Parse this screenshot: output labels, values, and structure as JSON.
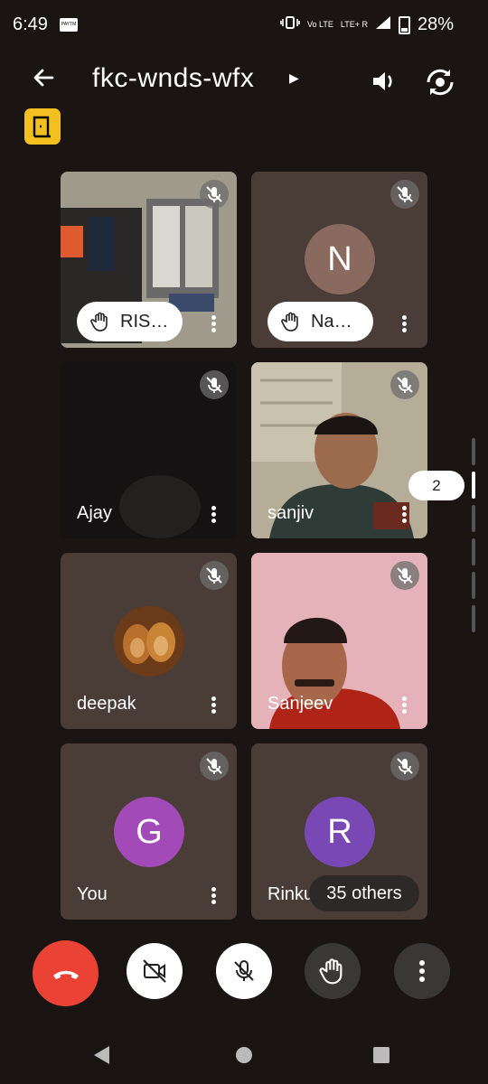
{
  "status_bar": {
    "time": "6:49",
    "app_icon_text": "PAYTM",
    "network": "Vo LTE",
    "network2": "LTE+ R",
    "battery": "28%"
  },
  "header": {
    "meeting_code": "fkc-wnds-wfx",
    "icons": [
      "back-arrow-icon",
      "speaker-icon",
      "switch-camera-icon",
      "exit-door-icon"
    ]
  },
  "participants": [
    {
      "name": "RIS…",
      "hand_raised": true,
      "kind": "video-room"
    },
    {
      "name": "Na…",
      "hand_raised": true,
      "kind": "avatar",
      "initial": "N",
      "color": "#8a6a5f"
    },
    {
      "name": "Ajay",
      "hand_raised": false,
      "kind": "video-dark"
    },
    {
      "name": "sanjiv",
      "hand_raised": false,
      "kind": "video-man1"
    },
    {
      "name": "deepak",
      "hand_raised": false,
      "kind": "lion-avatar"
    },
    {
      "name": "Sanjeev",
      "hand_raised": false,
      "kind": "video-man2"
    },
    {
      "name": "You",
      "hand_raised": false,
      "kind": "avatar",
      "initial": "G",
      "color": "#a24bb8"
    },
    {
      "name": "Rinku",
      "hand_raised": false,
      "kind": "avatar",
      "initial": "R",
      "color": "#7948b5"
    }
  ],
  "page_indicator": "2",
  "others_label": "35 others",
  "controls": {
    "colors": {
      "end_call": "#ea4335",
      "light": "#ffffff",
      "dark": "#3a3836"
    },
    "items": [
      "end-call",
      "camera-off",
      "mic-off",
      "raise-hand",
      "more-options"
    ]
  },
  "nav_bar": [
    "back",
    "home",
    "recents"
  ]
}
